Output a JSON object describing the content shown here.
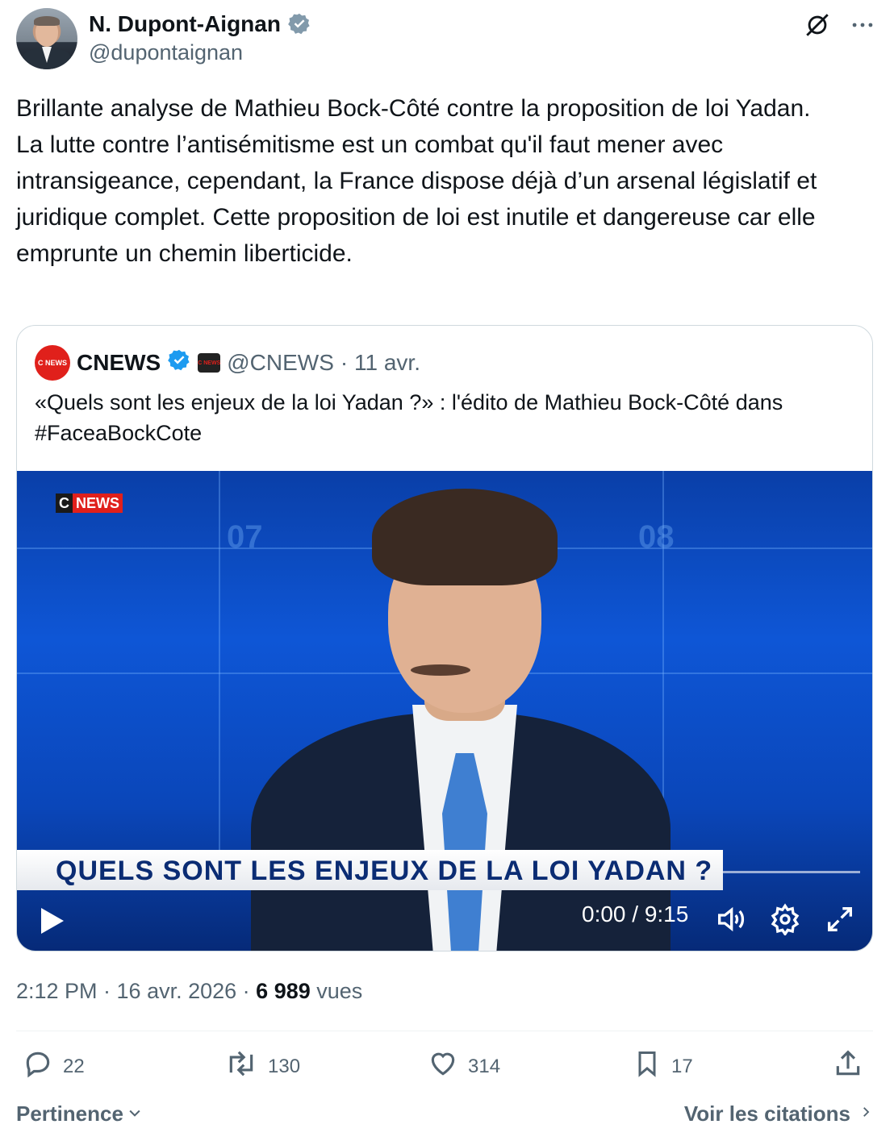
{
  "author": {
    "name": "N. Dupont-Aignan",
    "handle": "@dupontaignan",
    "verified": true
  },
  "tweet": {
    "text": "Brillante analyse de Mathieu Bock-Côté contre la proposition de loi Yadan.\nLa lutte contre l’antisémitisme est un combat qu'il faut mener avec intransigeance, cependant, la France dispose déjà d’un arsenal législatif et juridique complet. Cette proposition de loi est inutile et dangereuse car elle emprunte un chemin liberticide."
  },
  "quote": {
    "name": "CNEWS",
    "handle": "@CNEWS",
    "date": "· 11 avr.",
    "text": "«Quels sont les enjeux de la loi Yadan ?» : l'édito de Mathieu Bock-Côté dans #FaceaBockCote",
    "logo_text": "C NEWS",
    "video": {
      "channel_c": "C",
      "channel_news": "NEWS",
      "background_numbers": [
        "07",
        "08"
      ],
      "banner": "QUELS SONT LES ENJEUX DE LA LOI YADAN ?",
      "time": "0:00 / 9:15"
    }
  },
  "meta": {
    "time": "2:12 PM · 16 avr. 2026 · ",
    "views_count": "6 989",
    "views_label": "vues"
  },
  "actions": {
    "replies": "22",
    "reposts": "130",
    "likes": "314",
    "bookmarks": "17"
  },
  "footer": {
    "sort_label": "Pertinence",
    "quotes_label": "Voir les citations"
  },
  "colors": {
    "text": "#0f1419",
    "secondary": "#536471",
    "verified": "#1d9bf0",
    "cnews_red": "#e0201b"
  }
}
